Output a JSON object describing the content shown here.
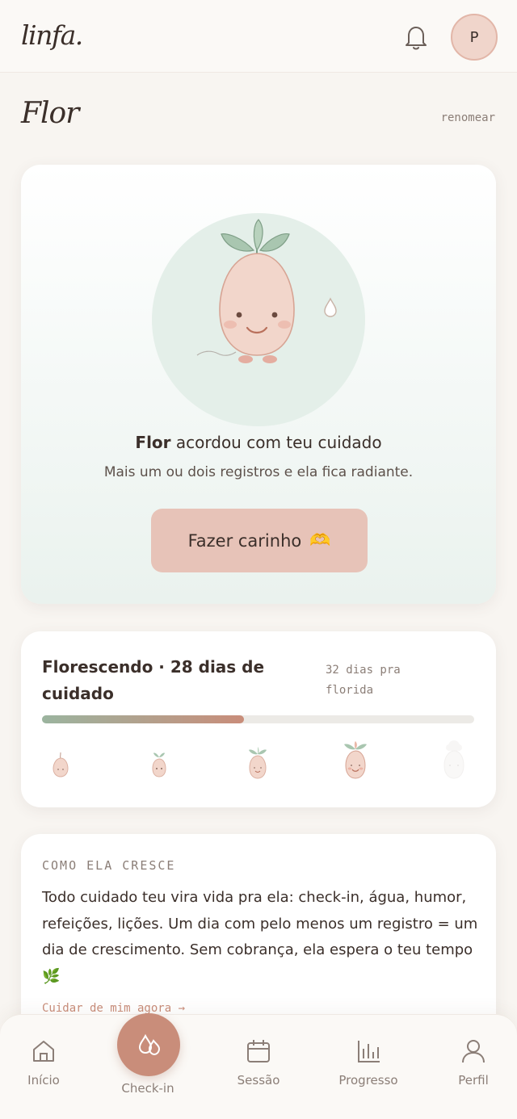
{
  "header": {
    "logo": "linfa.",
    "avatar_initial": "P",
    "bell_icon": "bell-icon"
  },
  "plant": {
    "name": "Flor",
    "rename_label": "renomear"
  },
  "hero": {
    "title_name": "Flor",
    "title_rest": " acordou com teu cuidado",
    "subtitle": "Mais um ou dois registros e ela fica radiante.",
    "button_label": "Fazer carinho",
    "button_emoji": "🫶"
  },
  "progress": {
    "title": "Florescendo · 28 dias de cuidado",
    "remaining": "32 dias pra florida",
    "fraction": 0.4667,
    "stages": [
      "seed",
      "sprout",
      "sapling",
      "bud",
      "bloom"
    ],
    "current_stage_index": 3
  },
  "how_it_grows": {
    "label": "COMO ELA CRESCE",
    "text": "Todo cuidado teu vira vida pra ela: check-in, água, humor, refeições, lições. Um dia com pelo menos um registro = um dia de crescimento. Sem cobrança, ela espera o teu tempo 🌿",
    "link": "Cuidar de mim agora →"
  },
  "nav": {
    "items": [
      {
        "label": "Início",
        "icon": "home-icon"
      },
      {
        "label": "Check-in",
        "icon": "drops-icon"
      },
      {
        "label": "Sessão",
        "icon": "calendar-icon"
      },
      {
        "label": "Progresso",
        "icon": "bar-chart-icon"
      },
      {
        "label": "Perfil",
        "icon": "user-icon"
      }
    ]
  },
  "colors": {
    "accent": "#c98d7a",
    "button": "#e7c3b8",
    "background": "#f8f5f1",
    "leaf": "#9bb49f"
  }
}
